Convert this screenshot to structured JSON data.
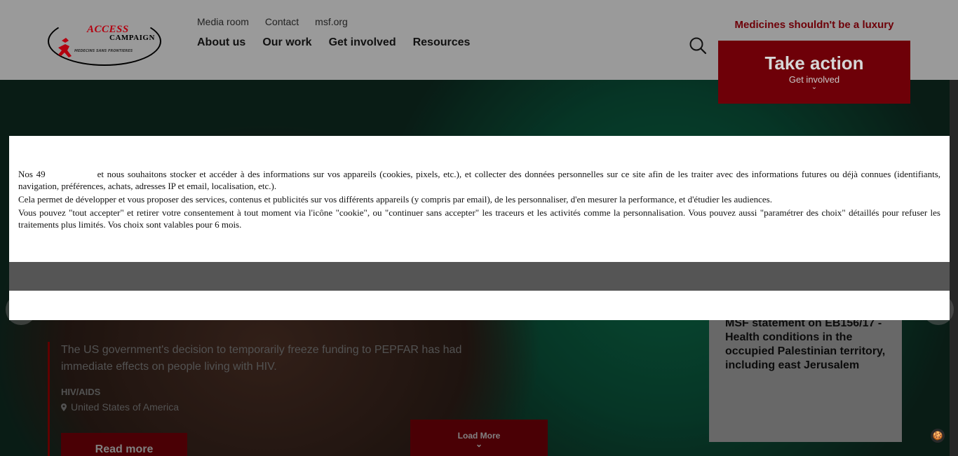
{
  "header": {
    "logo": {
      "line1": "ACCESS",
      "line2": "CAMPAIGN",
      "line3": "MEDECINS SANS FRONTIERES"
    },
    "util_nav": [
      "Media room",
      "Contact",
      "msf.org"
    ],
    "main_nav": [
      "About us",
      "Our work",
      "Get involved",
      "Resources"
    ],
    "tagline": "Medicines shouldn't be a luxury",
    "take_action": {
      "title": "Take action",
      "subtitle": "Get involved"
    }
  },
  "article": {
    "description": "The US government's decision to temporarily freeze funding to PEPFAR has had immediate effects on people living with HIV.",
    "tag": "HIV/AIDS",
    "location": "United States of America",
    "read_more": "Read more"
  },
  "load_more": "Load More",
  "side_card": {
    "title": "MSF statement on EB156/17 - Health conditions in the occupied Palestinian territory, including east Jerusalem"
  },
  "consent": {
    "p1_start": "Nos 49",
    "p1_rest": "et nous souhaitons stocker et accéder à des informations sur vos appareils (cookies, pixels, etc.), et collecter des données personnelles sur ce site afin de les traiter avec des informations futures ou déjà connues (identifiants, navigation, préférences, achats, adresses IP et email, localisation, etc.).",
    "p2": "Cela permet de développer et vous proposer des services, contenus et publicités sur vos différents appareils (y compris par email), de les personnaliser, d'en mesurer la performance, et d'étudier les audiences.",
    "p3": "Vous pouvez \"tout accepter\" et retirer votre consentement à tout moment via l'icône \"cookie\", ou \"continuer sans accepter\" les traceurs et les activités comme la personnalisation. Vous pouvez aussi \"paramétrer des choix\" détaillés pour refuser les traitements plus limités. Vos choix sont valables pour 6 mois."
  },
  "colors": {
    "brand_red": "#b3000f",
    "dim_red": "#6e0008"
  }
}
